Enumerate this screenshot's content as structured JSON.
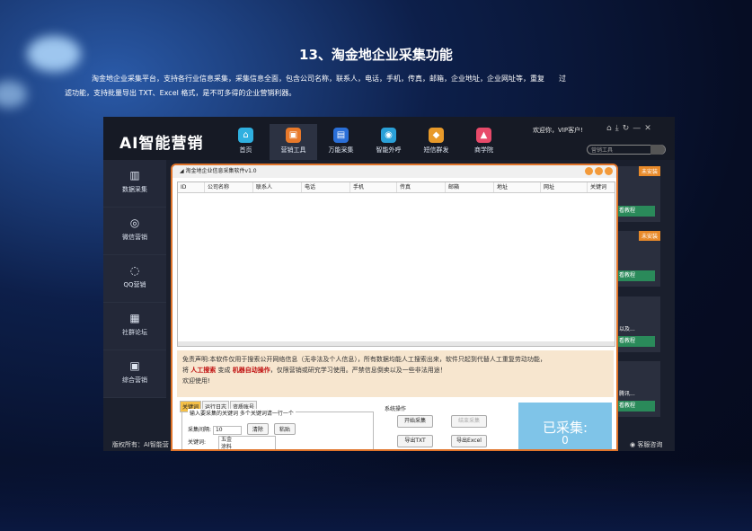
{
  "slide": {
    "title": "13、淘金地企业采集功能",
    "desc_line1": "淘金地企业采集平台，支持各行业信息采集，采集信息全面，包含公司名称，联系人，电话，手机，传真，邮箱，企业地址，企业网址等，重复　　过",
    "desc_line2": "滤功能，支持批量导出 TXT、Excel 格式，是不可多得的企业营销利器。"
  },
  "app": {
    "logo": "AI智能营销",
    "nav": [
      {
        "label": "首页",
        "color": "#2fb0e0",
        "glyph": "⌂"
      },
      {
        "label": "营销工具",
        "color": "#e8792a",
        "glyph": "▣"
      },
      {
        "label": "万能采集",
        "color": "#2a6fd8",
        "glyph": "▤"
      },
      {
        "label": "智能外呼",
        "color": "#2aa0d8",
        "glyph": "◉"
      },
      {
        "label": "短信群发",
        "color": "#e89a2a",
        "glyph": "◆"
      },
      {
        "label": "商学院",
        "color": "#e84a6a",
        "glyph": "▲"
      }
    ],
    "welcome": "欢迎你，VIP客户!",
    "search_placeholder": "营销工具",
    "sidebar": [
      {
        "label": "数据采集",
        "glyph": "▥"
      },
      {
        "label": "微信营销",
        "glyph": "◎"
      },
      {
        "label": "QQ营销",
        "glyph": "◌"
      },
      {
        "label": "社群论坛",
        "glyph": "▦"
      },
      {
        "label": "综合营销",
        "glyph": "▣"
      }
    ],
    "copyright": "版权所有：AI智能营",
    "service": "客服咨询",
    "cards": [
      {
        "tag": "未安装",
        "btn": "看教程",
        "text": ""
      },
      {
        "tag": "未安装",
        "btn": "看教程",
        "text": ""
      },
      {
        "tag": "",
        "btn": "看教程",
        "text": "以及..."
      },
      {
        "tag": "",
        "btn": "看教程",
        "text": "腾讯..."
      }
    ]
  },
  "software": {
    "title": "淘金地企业信息采集软件v1.0",
    "columns": [
      "ID",
      "公司名称",
      "联系人",
      "电话",
      "手机",
      "传真",
      "邮箱",
      "地址",
      "网址",
      "关键词"
    ],
    "notice_1": "免责声明:本软件仅用于搜索公开网络信息（无非法及个人信息），所有数据均能人工搜索出来，软件只起到代替人工重复劳动功能，",
    "notice_2a": "将",
    "notice_2b": "人工搜索",
    "notice_2c": "变成",
    "notice_2d": "机器自动操作",
    "notice_2e": "，仅限营销或研究学习使用。严禁信息倒卖以及一些非法用途！",
    "notice_3": "欢迎使用!",
    "tabs": [
      "关键词",
      "运行日志",
      "资质账号"
    ],
    "kw_legend": "输入要采集的关键词 多个关键词请一行一个",
    "interval_label": "采集间隔:",
    "interval_value": "10",
    "clear_btn": "清除",
    "paste_btn": "粘贴",
    "kw_label": "关键词:",
    "kw_values": [
      "五金",
      "涂料"
    ],
    "sys_label": "系统操作",
    "start_btn": "开始采集",
    "stop_btn": "结束采集",
    "export_txt": "导出TXT",
    "export_excel": "导出Excel",
    "collected_label": "已采集:",
    "collected_count": "0"
  }
}
